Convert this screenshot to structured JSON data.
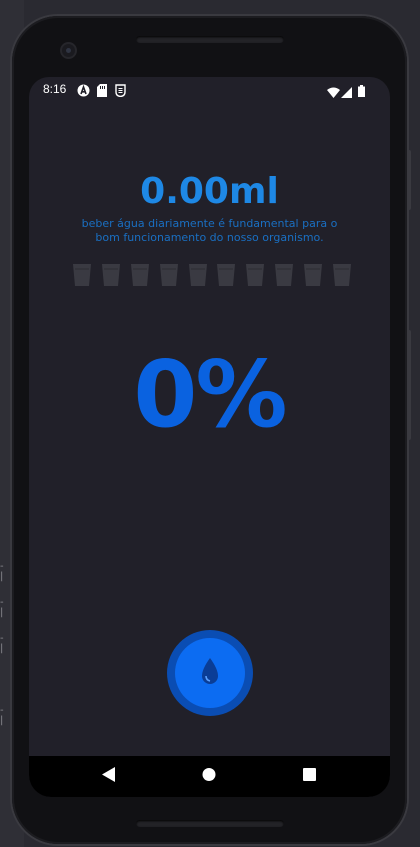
{
  "statusbar": {
    "time": "8:16",
    "icons_left": [
      "a-icon",
      "sd-card-icon",
      "shield-icon"
    ],
    "icons_right": [
      "wifi-icon",
      "signal-icon",
      "battery-icon"
    ]
  },
  "app": {
    "amount": "0.00ml",
    "subtitle": "beber água diariamente é fundamental para o bom funcionamento do nosso organismo.",
    "cups_total": 10,
    "cups_filled": 0,
    "percent": "0%",
    "drink_button_icon": "water-drop-icon"
  },
  "colors": {
    "accent": "#1e88e5",
    "percent": "#0a62e0",
    "background": "#212029",
    "cup": "#3a3a42"
  },
  "navbar": {
    "back_icon": "back-triangle-icon",
    "home_icon": "home-circle-icon",
    "recents_icon": "recents-square-icon"
  }
}
